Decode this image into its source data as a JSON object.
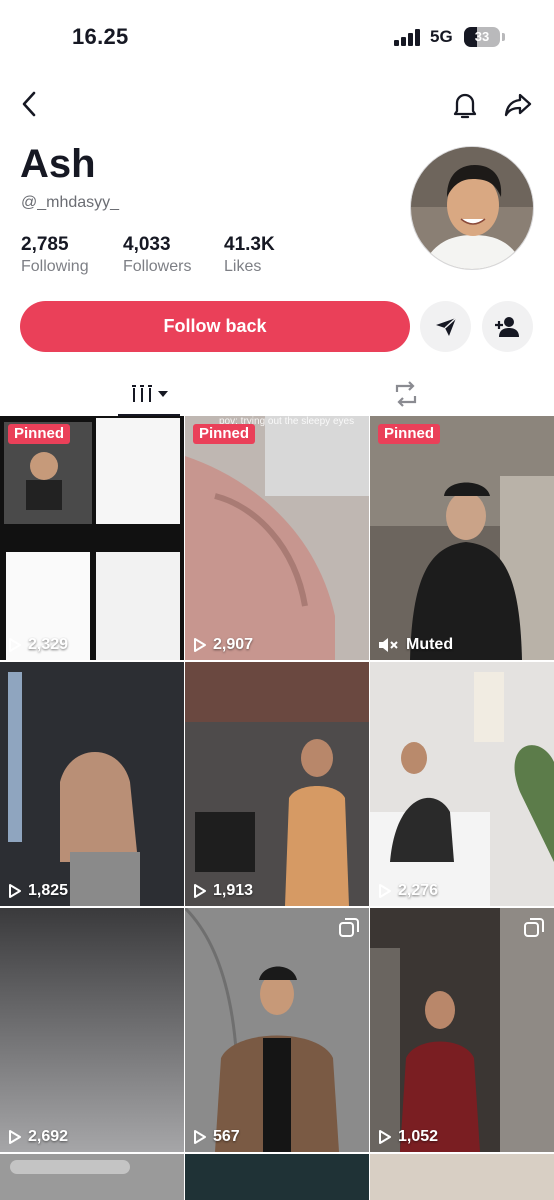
{
  "status_bar": {
    "time": "16.25",
    "network": "5G",
    "battery": "33",
    "battery_level": 0.33
  },
  "profile": {
    "display_name": "Ash",
    "username": "@_mhdasyy_",
    "stats": [
      {
        "value": "2,785",
        "label": "Following"
      },
      {
        "value": "4,033",
        "label": "Followers"
      },
      {
        "value": "41.3K",
        "label": "Likes"
      }
    ]
  },
  "actions": {
    "follow_label": "Follow back"
  },
  "icons": {
    "back": "chevron-left-icon",
    "notifications": "bell-icon",
    "share": "share-arrow-icon",
    "message": "send-icon",
    "add_friend": "add-user-icon",
    "videos_tab": "grid-icon",
    "reposts_tab": "repost-icon",
    "play": "play-icon",
    "muted": "muted-speaker-icon",
    "carousel": "photo-stack-icon"
  },
  "colors": {
    "accent": "#ea4059",
    "text": "#161823",
    "secondary_text": "#7d7f85",
    "button_bg": "#f1f1f2"
  },
  "grid": {
    "pinned_label": "Pinned",
    "tiles": [
      {
        "views": "2,329",
        "pinned": true,
        "caption": ""
      },
      {
        "views": "2,907",
        "pinned": true,
        "caption": "pov: trying out the sleepy eyes trend"
      },
      {
        "views": "Muted",
        "pinned": true,
        "muted": true,
        "caption": ""
      },
      {
        "views": "1,825",
        "pinned": false,
        "caption": ""
      },
      {
        "views": "1,913",
        "pinned": false,
        "caption": ""
      },
      {
        "views": "2,276",
        "pinned": false,
        "caption": ""
      },
      {
        "views": "2,692",
        "pinned": false,
        "caption": ""
      },
      {
        "views": "567",
        "pinned": false,
        "carousel": true,
        "caption": ""
      },
      {
        "views": "1,052",
        "pinned": false,
        "carousel": true,
        "caption": ""
      }
    ]
  }
}
